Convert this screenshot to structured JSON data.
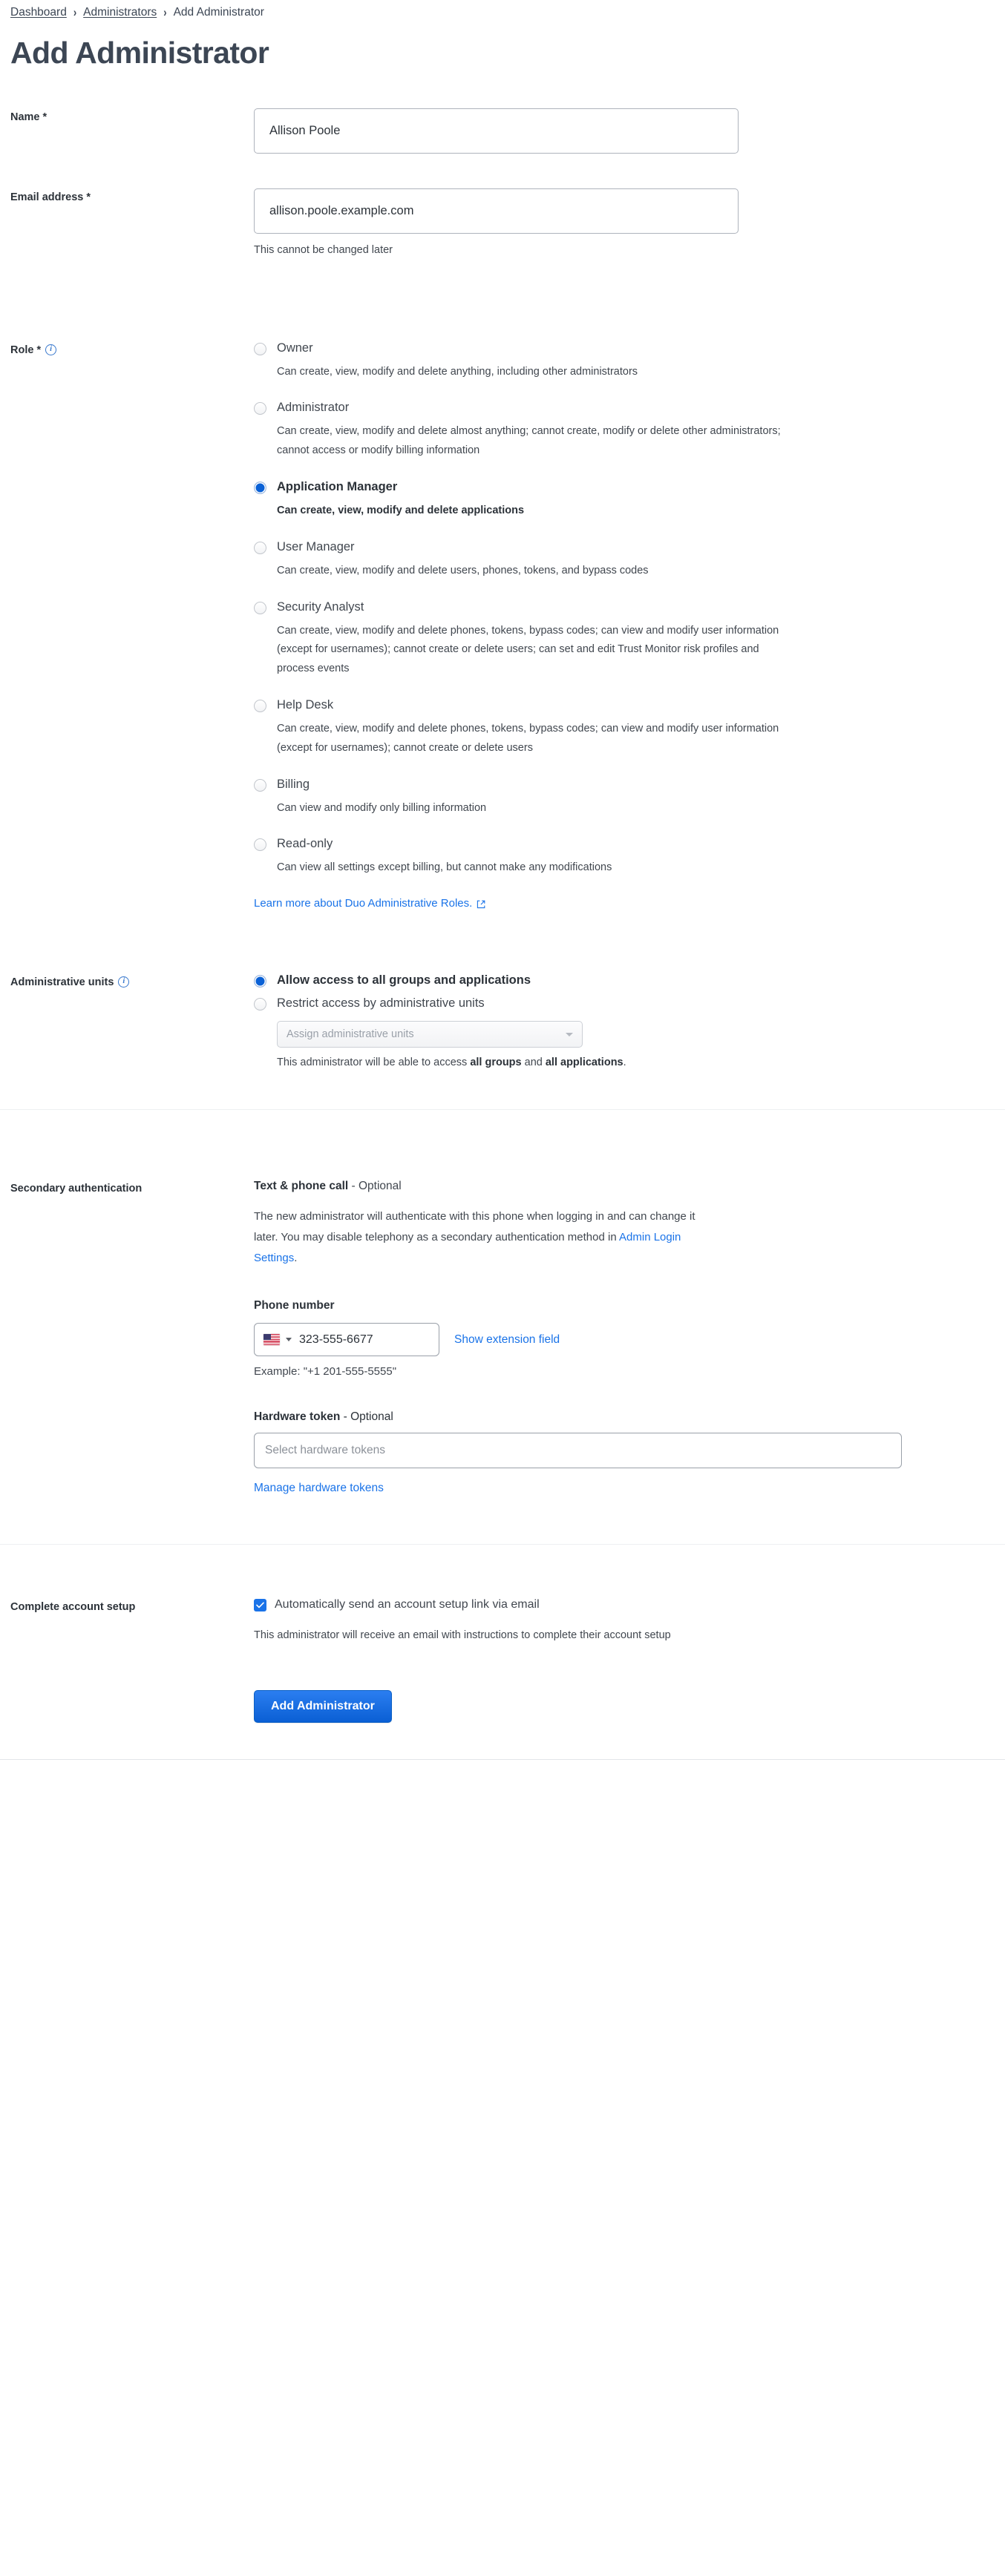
{
  "breadcrumb": {
    "items": [
      {
        "label": "Dashboard",
        "link": true
      },
      {
        "label": "Administrators",
        "link": true
      },
      {
        "label": "Add Administrator",
        "link": false
      }
    ],
    "separator": "›"
  },
  "page_title": "Add Administrator",
  "name_field": {
    "label": "Name *",
    "value": "Allison Poole"
  },
  "email_field": {
    "label": "Email address *",
    "value": "allison.poole.example.com",
    "helper": "This cannot be changed later"
  },
  "role_section": {
    "label": "Role *",
    "info_icon": "info-icon",
    "options": [
      {
        "label": "Owner",
        "description": "Can create, view, modify and delete anything, including other administrators",
        "selected": false
      },
      {
        "label": "Administrator",
        "description": "Can create, view, modify and delete almost anything; cannot create, modify or delete other administrators; cannot access or modify billing information",
        "selected": false
      },
      {
        "label": "Application Manager",
        "description": "Can create, view, modify and delete applications",
        "selected": true
      },
      {
        "label": "User Manager",
        "description": "Can create, view, modify and delete users, phones, tokens, and bypass codes",
        "selected": false
      },
      {
        "label": "Security Analyst",
        "description": "Can create, view, modify and delete phones, tokens, bypass codes; can view and modify user information (except for usernames); cannot create or delete users; can set and edit Trust Monitor risk profiles and process events",
        "selected": false
      },
      {
        "label": "Help Desk",
        "description": "Can create, view, modify and delete phones, tokens, bypass codes; can view and modify user information (except for usernames); cannot create or delete users",
        "selected": false
      },
      {
        "label": "Billing",
        "description": "Can view and modify only billing information",
        "selected": false
      },
      {
        "label": "Read-only",
        "description": "Can view all settings except billing, but cannot make any modifications",
        "selected": false
      }
    ],
    "learn_more": "Learn more about Duo Administrative Roles.",
    "learn_more_icon": "external-link-icon"
  },
  "admin_units": {
    "label": "Administrative units",
    "info_icon": "info-icon",
    "options": [
      {
        "label": "Allow access to all groups and applications",
        "selected": true
      },
      {
        "label": "Restrict access by administrative units",
        "selected": false
      }
    ],
    "select_placeholder": "Assign administrative units",
    "note_prefix": "This administrator will be able to access ",
    "note_bold_1": "all groups",
    "note_middle": " and ",
    "note_bold_2": "all applications",
    "note_suffix": "."
  },
  "secondary_auth": {
    "label": "Secondary authentication",
    "heading_bold": "Text & phone call",
    "heading_rest": " - Optional",
    "paragraph_1": "The new administrator will authenticate with this phone when logging in and can change it later. You may disable telephony as a secondary authentication method in ",
    "paragraph_link": "Admin Login Settings",
    "paragraph_2": ".",
    "phone_label": "Phone number",
    "phone_country_icon": "us-flag-icon",
    "phone_value": "323-555-6677",
    "show_extension": "Show extension field",
    "example": "Example: \"+1 201-555-5555\"",
    "token_heading_bold": "Hardware token",
    "token_heading_rest": " - Optional",
    "token_placeholder": "Select hardware tokens",
    "manage_tokens": "Manage hardware tokens"
  },
  "complete_setup": {
    "label": "Complete account setup",
    "checkbox_label": "Automatically send an account setup link via email",
    "checkbox_checked": true,
    "note": "This administrator will receive an email with instructions to complete their account setup"
  },
  "submit_button": "Add Administrator",
  "colors": {
    "accent": "#1a73e8",
    "radio_selected": "#0a61d6",
    "text": "#2c3239",
    "muted": "#41474f"
  }
}
